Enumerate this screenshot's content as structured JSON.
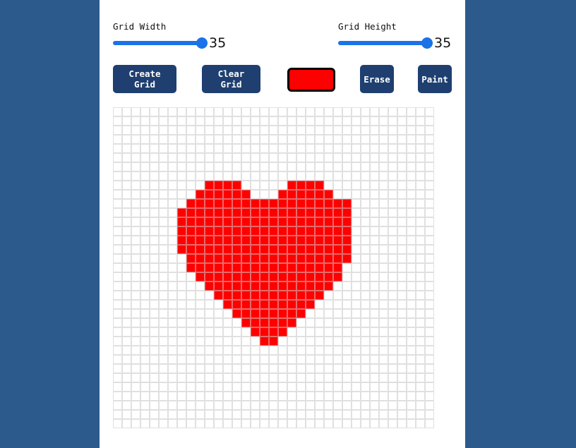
{
  "controls": {
    "grid_width": {
      "label": "Grid Width",
      "value": "35",
      "fraction": 1.0
    },
    "grid_height": {
      "label": "Grid Height",
      "value": "35",
      "fraction": 1.0
    }
  },
  "buttons": {
    "create_grid": "Create Grid",
    "clear_grid": "Clear Grid",
    "erase": "Erase",
    "paint": "Paint"
  },
  "colors": {
    "background": "#2c5a8c",
    "panel": "#ffffff",
    "button": "#1e3f70",
    "slider_accent": "#1a73e8",
    "selected_paint_color": "#ff0000",
    "grid_line": "#e0e0e0"
  },
  "grid": {
    "columns": 35,
    "rows": 35,
    "painted_rows": [
      {
        "row": 8,
        "spans": [
          [
            10,
            13
          ],
          [
            19,
            22
          ]
        ]
      },
      {
        "row": 9,
        "spans": [
          [
            9,
            14
          ],
          [
            18,
            23
          ]
        ]
      },
      {
        "row": 10,
        "spans": [
          [
            8,
            25
          ]
        ]
      },
      {
        "row": 11,
        "spans": [
          [
            7,
            25
          ]
        ]
      },
      {
        "row": 12,
        "spans": [
          [
            7,
            25
          ]
        ]
      },
      {
        "row": 13,
        "spans": [
          [
            7,
            25
          ]
        ]
      },
      {
        "row": 14,
        "spans": [
          [
            7,
            25
          ]
        ]
      },
      {
        "row": 15,
        "spans": [
          [
            7,
            25
          ]
        ]
      },
      {
        "row": 16,
        "spans": [
          [
            8,
            25
          ]
        ]
      },
      {
        "row": 17,
        "spans": [
          [
            8,
            24
          ]
        ]
      },
      {
        "row": 18,
        "spans": [
          [
            9,
            24
          ]
        ]
      },
      {
        "row": 19,
        "spans": [
          [
            10,
            23
          ]
        ]
      },
      {
        "row": 20,
        "spans": [
          [
            11,
            22
          ]
        ]
      },
      {
        "row": 21,
        "spans": [
          [
            12,
            21
          ]
        ]
      },
      {
        "row": 22,
        "spans": [
          [
            13,
            20
          ]
        ]
      },
      {
        "row": 23,
        "spans": [
          [
            14,
            19
          ]
        ]
      },
      {
        "row": 24,
        "spans": [
          [
            15,
            18
          ]
        ]
      },
      {
        "row": 25,
        "spans": [
          [
            16,
            17
          ]
        ]
      }
    ]
  }
}
